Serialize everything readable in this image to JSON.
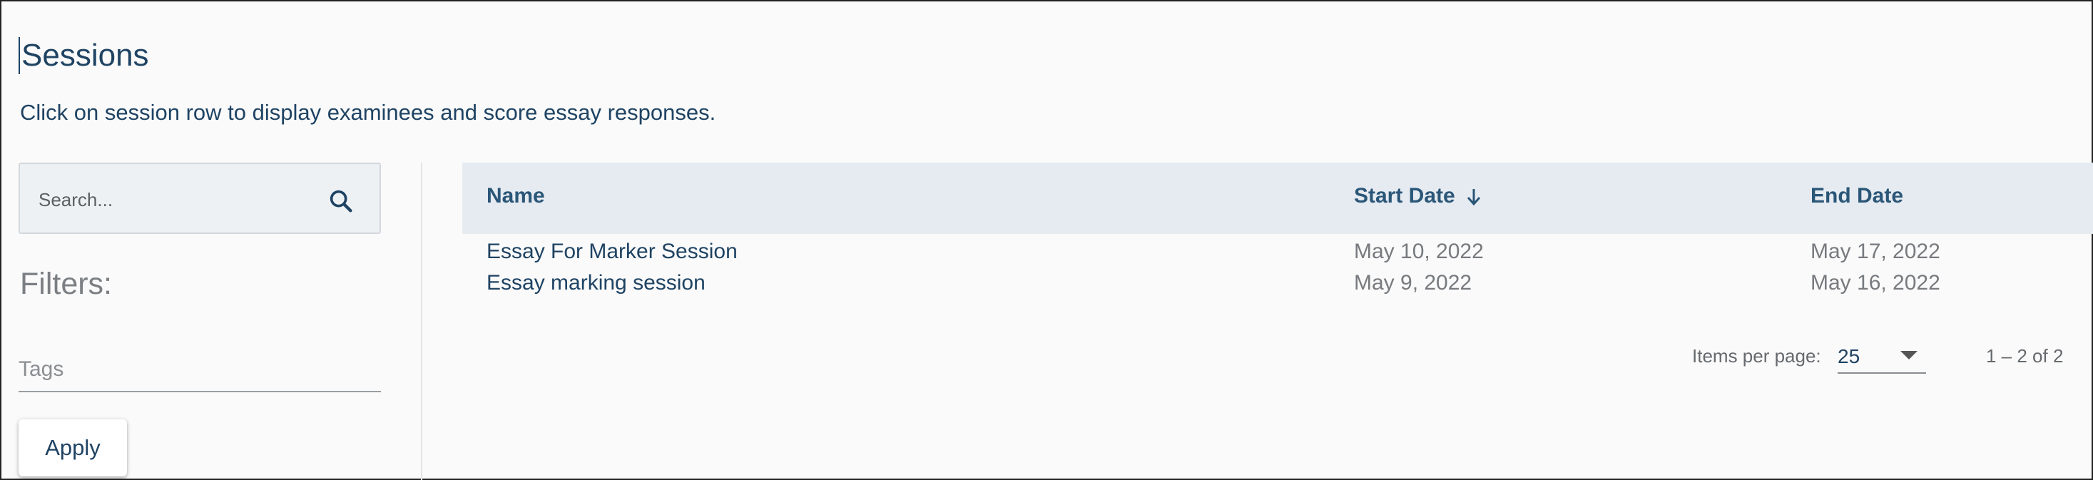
{
  "page": {
    "title": "Sessions",
    "subtitle": "Click on session row to display examinees and score essay responses."
  },
  "sidebar": {
    "search_placeholder": "Search...",
    "search_icon": "search-icon",
    "filters_title": "Filters:",
    "tags_placeholder": "Tags",
    "apply_label": "Apply"
  },
  "table": {
    "columns": {
      "name": "Name",
      "start_date": "Start Date",
      "end_date": "End Date"
    },
    "sort": {
      "column": "start_date",
      "direction": "descending"
    },
    "rows": [
      {
        "name": "Essay For Marker Session",
        "start_date": "May 10, 2022",
        "end_date": "May 17, 2022"
      },
      {
        "name": "Essay marking session",
        "start_date": "May 9, 2022",
        "end_date": "May 16, 2022"
      }
    ]
  },
  "paginator": {
    "items_per_page_label": "Items per page:",
    "items_per_page_value": "25",
    "range_label": "1 – 2 of 2"
  },
  "colors": {
    "primary_text": "#1f4363",
    "header_bg": "#e6ebf1",
    "header_text": "#2a5678",
    "muted_text": "#777a7e"
  }
}
